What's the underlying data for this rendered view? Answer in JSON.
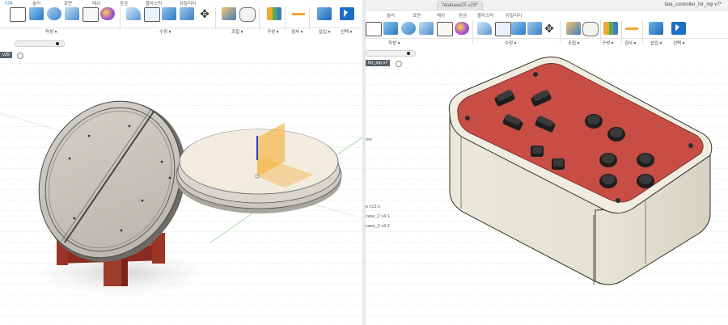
{
  "left": {
    "menu": [
      "디자",
      "솔리",
      "표면",
      "메쉬",
      "판금",
      "플라스틱",
      "유틸리티"
    ],
    "groups": [
      "작성 ▾",
      "수정 ▾",
      "조립 ▾",
      "구성 ▾",
      "검사 ▾",
      "삽입 ▾",
      "선택 ▾"
    ],
    "browser_tab": "v29"
  },
  "right": {
    "doc_tab": "fatabase25 v29*",
    "doc_title": "fata_controller_for_mp v7*",
    "menu": [
      "솔리",
      "표면",
      "메쉬",
      "판금",
      "플라스틱",
      "유틸리티"
    ],
    "groups": [
      "작성 ▾",
      "수정 ▾",
      "조립 ▾",
      "구성 ▾",
      "검사 ▾",
      "삽입 ▾",
      "선택 ▾"
    ],
    "browser_tab": "for_mp v7",
    "browser_items": [
      "me",
      "e v13:1",
      "case_2 v4:1",
      "case_2 v4:2"
    ]
  }
}
